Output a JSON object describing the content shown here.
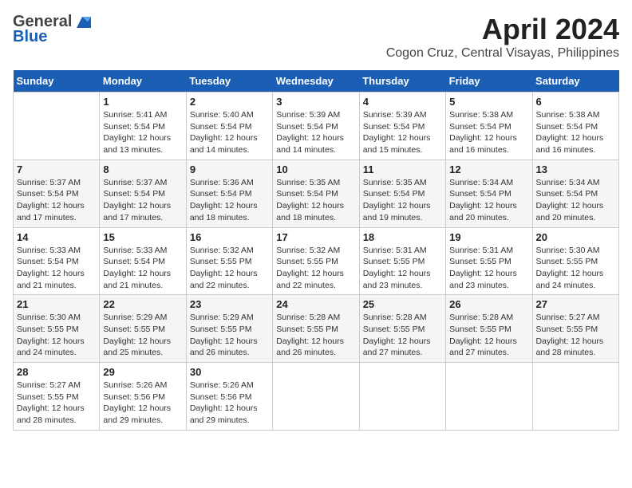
{
  "header": {
    "logo_general": "General",
    "logo_blue": "Blue",
    "month": "April 2024",
    "location": "Cogon Cruz, Central Visayas, Philippines"
  },
  "weekdays": [
    "Sunday",
    "Monday",
    "Tuesday",
    "Wednesday",
    "Thursday",
    "Friday",
    "Saturday"
  ],
  "weeks": [
    [
      {
        "day": "",
        "sunrise": "",
        "sunset": "",
        "daylight": ""
      },
      {
        "day": "1",
        "sunrise": "Sunrise: 5:41 AM",
        "sunset": "Sunset: 5:54 PM",
        "daylight": "Daylight: 12 hours and 13 minutes."
      },
      {
        "day": "2",
        "sunrise": "Sunrise: 5:40 AM",
        "sunset": "Sunset: 5:54 PM",
        "daylight": "Daylight: 12 hours and 14 minutes."
      },
      {
        "day": "3",
        "sunrise": "Sunrise: 5:39 AM",
        "sunset": "Sunset: 5:54 PM",
        "daylight": "Daylight: 12 hours and 14 minutes."
      },
      {
        "day": "4",
        "sunrise": "Sunrise: 5:39 AM",
        "sunset": "Sunset: 5:54 PM",
        "daylight": "Daylight: 12 hours and 15 minutes."
      },
      {
        "day": "5",
        "sunrise": "Sunrise: 5:38 AM",
        "sunset": "Sunset: 5:54 PM",
        "daylight": "Daylight: 12 hours and 16 minutes."
      },
      {
        "day": "6",
        "sunrise": "Sunrise: 5:38 AM",
        "sunset": "Sunset: 5:54 PM",
        "daylight": "Daylight: 12 hours and 16 minutes."
      }
    ],
    [
      {
        "day": "7",
        "sunrise": "Sunrise: 5:37 AM",
        "sunset": "Sunset: 5:54 PM",
        "daylight": "Daylight: 12 hours and 17 minutes."
      },
      {
        "day": "8",
        "sunrise": "Sunrise: 5:37 AM",
        "sunset": "Sunset: 5:54 PM",
        "daylight": "Daylight: 12 hours and 17 minutes."
      },
      {
        "day": "9",
        "sunrise": "Sunrise: 5:36 AM",
        "sunset": "Sunset: 5:54 PM",
        "daylight": "Daylight: 12 hours and 18 minutes."
      },
      {
        "day": "10",
        "sunrise": "Sunrise: 5:35 AM",
        "sunset": "Sunset: 5:54 PM",
        "daylight": "Daylight: 12 hours and 18 minutes."
      },
      {
        "day": "11",
        "sunrise": "Sunrise: 5:35 AM",
        "sunset": "Sunset: 5:54 PM",
        "daylight": "Daylight: 12 hours and 19 minutes."
      },
      {
        "day": "12",
        "sunrise": "Sunrise: 5:34 AM",
        "sunset": "Sunset: 5:54 PM",
        "daylight": "Daylight: 12 hours and 20 minutes."
      },
      {
        "day": "13",
        "sunrise": "Sunrise: 5:34 AM",
        "sunset": "Sunset: 5:54 PM",
        "daylight": "Daylight: 12 hours and 20 minutes."
      }
    ],
    [
      {
        "day": "14",
        "sunrise": "Sunrise: 5:33 AM",
        "sunset": "Sunset: 5:54 PM",
        "daylight": "Daylight: 12 hours and 21 minutes."
      },
      {
        "day": "15",
        "sunrise": "Sunrise: 5:33 AM",
        "sunset": "Sunset: 5:54 PM",
        "daylight": "Daylight: 12 hours and 21 minutes."
      },
      {
        "day": "16",
        "sunrise": "Sunrise: 5:32 AM",
        "sunset": "Sunset: 5:55 PM",
        "daylight": "Daylight: 12 hours and 22 minutes."
      },
      {
        "day": "17",
        "sunrise": "Sunrise: 5:32 AM",
        "sunset": "Sunset: 5:55 PM",
        "daylight": "Daylight: 12 hours and 22 minutes."
      },
      {
        "day": "18",
        "sunrise": "Sunrise: 5:31 AM",
        "sunset": "Sunset: 5:55 PM",
        "daylight": "Daylight: 12 hours and 23 minutes."
      },
      {
        "day": "19",
        "sunrise": "Sunrise: 5:31 AM",
        "sunset": "Sunset: 5:55 PM",
        "daylight": "Daylight: 12 hours and 23 minutes."
      },
      {
        "day": "20",
        "sunrise": "Sunrise: 5:30 AM",
        "sunset": "Sunset: 5:55 PM",
        "daylight": "Daylight: 12 hours and 24 minutes."
      }
    ],
    [
      {
        "day": "21",
        "sunrise": "Sunrise: 5:30 AM",
        "sunset": "Sunset: 5:55 PM",
        "daylight": "Daylight: 12 hours and 24 minutes."
      },
      {
        "day": "22",
        "sunrise": "Sunrise: 5:29 AM",
        "sunset": "Sunset: 5:55 PM",
        "daylight": "Daylight: 12 hours and 25 minutes."
      },
      {
        "day": "23",
        "sunrise": "Sunrise: 5:29 AM",
        "sunset": "Sunset: 5:55 PM",
        "daylight": "Daylight: 12 hours and 26 minutes."
      },
      {
        "day": "24",
        "sunrise": "Sunrise: 5:28 AM",
        "sunset": "Sunset: 5:55 PM",
        "daylight": "Daylight: 12 hours and 26 minutes."
      },
      {
        "day": "25",
        "sunrise": "Sunrise: 5:28 AM",
        "sunset": "Sunset: 5:55 PM",
        "daylight": "Daylight: 12 hours and 27 minutes."
      },
      {
        "day": "26",
        "sunrise": "Sunrise: 5:28 AM",
        "sunset": "Sunset: 5:55 PM",
        "daylight": "Daylight: 12 hours and 27 minutes."
      },
      {
        "day": "27",
        "sunrise": "Sunrise: 5:27 AM",
        "sunset": "Sunset: 5:55 PM",
        "daylight": "Daylight: 12 hours and 28 minutes."
      }
    ],
    [
      {
        "day": "28",
        "sunrise": "Sunrise: 5:27 AM",
        "sunset": "Sunset: 5:55 PM",
        "daylight": "Daylight: 12 hours and 28 minutes."
      },
      {
        "day": "29",
        "sunrise": "Sunrise: 5:26 AM",
        "sunset": "Sunset: 5:56 PM",
        "daylight": "Daylight: 12 hours and 29 minutes."
      },
      {
        "day": "30",
        "sunrise": "Sunrise: 5:26 AM",
        "sunset": "Sunset: 5:56 PM",
        "daylight": "Daylight: 12 hours and 29 minutes."
      },
      {
        "day": "",
        "sunrise": "",
        "sunset": "",
        "daylight": ""
      },
      {
        "day": "",
        "sunrise": "",
        "sunset": "",
        "daylight": ""
      },
      {
        "day": "",
        "sunrise": "",
        "sunset": "",
        "daylight": ""
      },
      {
        "day": "",
        "sunrise": "",
        "sunset": "",
        "daylight": ""
      }
    ]
  ]
}
